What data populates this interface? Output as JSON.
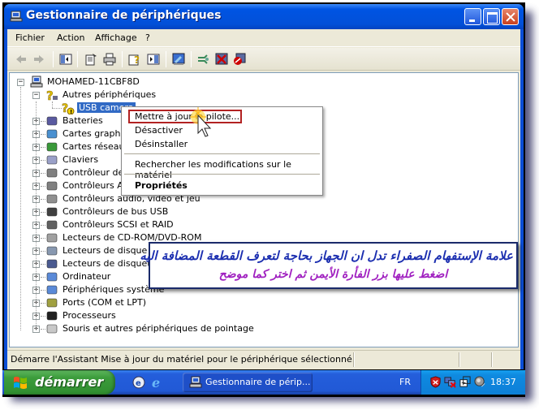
{
  "window": {
    "title": "Gestionnaire de périphériques",
    "controls": [
      "minimize",
      "maximize",
      "close"
    ]
  },
  "menubar": [
    "Fichier",
    "Action",
    "Affichage",
    "?"
  ],
  "toolbar": {
    "buttons": [
      "back-arrow",
      "forward-arrow",
      "show-hide-console-tree",
      "properties",
      "print",
      "help",
      "show-hide-action-pane",
      "update-driver",
      "scan-hardware-changes",
      "uninstall",
      "disable"
    ]
  },
  "tree": {
    "root": "MOHAMED-11CBF8D",
    "other_devices": "Autres périphériques",
    "usb_camera": "USB camera",
    "categories": [
      "Batteries",
      "Cartes graphiques",
      "Cartes réseau",
      "Claviers",
      "Contrôleur de lecteur de disquettes",
      "Contrôleurs ATA/ATAPI IDE",
      "Contrôleurs audio, vidéo et jeu",
      "Contrôleurs de bus USB",
      "Contrôleurs SCSI et RAID",
      "Lecteurs de CD-ROM/DVD-ROM",
      "Lecteurs de disque",
      "Lecteurs de disquettes",
      "Ordinateur",
      "Périphériques système",
      "Ports (COM et LPT)",
      "Processeurs",
      "Souris et autres périphériques de pointage"
    ]
  },
  "context_menu": {
    "update_driver": "Mettre à jour le pilote...",
    "disable": "Désactiver",
    "uninstall": "Désinstaller",
    "scan": "Rechercher les modifications sur le matériel",
    "properties": "Propriétés"
  },
  "annotation": {
    "line1": "علامة الإستفهام الصفراء تدل ان الجهاز بحاجة لتعرف القطعة المضافة اليه",
    "line2": "اضغط عليها بزر الفأرة الأيمن ثم اختر كما موضح"
  },
  "statusbar": {
    "text": "Démarre l'Assistant Mise à jour du matériel pour le périphérique sélectionné."
  },
  "taskbar": {
    "start_label": "démarrer",
    "task_button": "Gestionnaire de périp...",
    "language": "FR",
    "clock": "18:37"
  }
}
